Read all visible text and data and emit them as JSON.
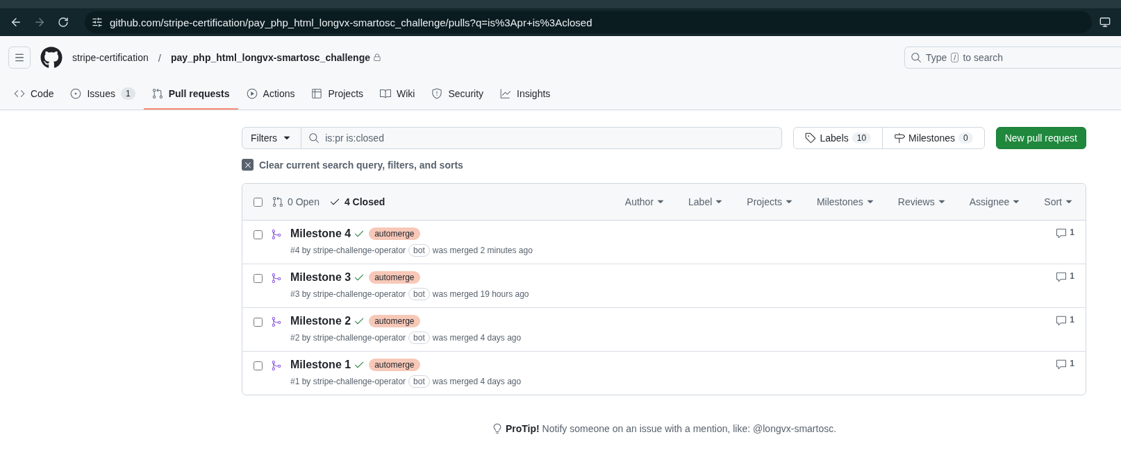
{
  "browser": {
    "url": "github.com/stripe-certification/pay_php_html_longvx-smartosc_challenge/pulls?q=is%3Apr+is%3Aclosed"
  },
  "header": {
    "owner": "stripe-certification",
    "separator": "/",
    "repo": "pay_php_html_longvx-smartosc_challenge",
    "private": true,
    "search": {
      "before": "Type",
      "key": "/",
      "after": "to search"
    }
  },
  "repo_tabs": [
    {
      "label": "Code",
      "selected": false
    },
    {
      "label": "Issues",
      "counter": "1",
      "selected": false
    },
    {
      "label": "Pull requests",
      "selected": true
    },
    {
      "label": "Actions",
      "selected": false
    },
    {
      "label": "Projects",
      "selected": false
    },
    {
      "label": "Wiki",
      "selected": false
    },
    {
      "label": "Security",
      "selected": false
    },
    {
      "label": "Insights",
      "selected": false
    }
  ],
  "filters": {
    "button": "Filters",
    "query": "is:pr is:closed",
    "labels": {
      "label": "Labels",
      "count": "10"
    },
    "milestones": {
      "label": "Milestones",
      "count": "0"
    },
    "new_button": "New pull request"
  },
  "clear": "Clear current search query, filters, and sorts",
  "list": {
    "checked": false,
    "states": [
      {
        "label": "0 Open",
        "selected": false
      },
      {
        "label": "4 Closed",
        "selected": true
      }
    ],
    "menus": [
      "Author",
      "Label",
      "Projects",
      "Milestones",
      "Reviews",
      "Assignee",
      "Sort"
    ],
    "rows": [
      {
        "title": "Milestone 4",
        "label": "automerge",
        "meta_before": "#4 by stripe-challenge-operator",
        "badge": "bot",
        "meta_after": "was merged 2 minutes ago",
        "comments": "1",
        "checked": false
      },
      {
        "title": "Milestone 3",
        "label": "automerge",
        "meta_before": "#3 by stripe-challenge-operator",
        "badge": "bot",
        "meta_after": "was merged 19 hours ago",
        "comments": "1",
        "checked": false
      },
      {
        "title": "Milestone 2",
        "label": "automerge",
        "meta_before": "#2 by stripe-challenge-operator",
        "badge": "bot",
        "meta_after": "was merged 4 days ago",
        "comments": "1",
        "checked": false
      },
      {
        "title": "Milestone 1",
        "label": "automerge",
        "meta_before": "#1 by stripe-challenge-operator",
        "badge": "bot",
        "meta_after": "was merged 4 days ago",
        "comments": "1",
        "checked": false
      }
    ]
  },
  "protip": "**ProTip!** Notify someone on an issue with a mention, like: @longvx-smartosc."
}
